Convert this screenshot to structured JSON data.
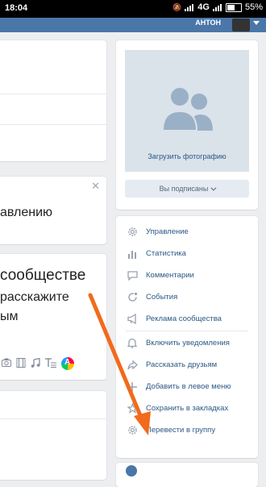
{
  "status_bar": {
    "time": "18:04",
    "network": "4G",
    "battery": "55%"
  },
  "header": {
    "user_name": "АНТОН"
  },
  "left_column": {
    "card2_text": "авлению",
    "card2_close": "✕",
    "card3_title": "сообществе",
    "card3_line1": "расскажите",
    "card3_line2": "ым"
  },
  "right_column": {
    "upload_photo_label": "Загрузить фотографию",
    "subscribed_label": "Вы подписаны",
    "menu": [
      {
        "icon": "gear-icon",
        "label": "Управление"
      },
      {
        "icon": "statistics-icon",
        "label": "Статистика"
      },
      {
        "icon": "comment-icon",
        "label": "Комментарии"
      },
      {
        "icon": "events-icon",
        "label": "События"
      },
      {
        "icon": "megaphone-icon",
        "label": "Реклама сообщества"
      },
      {
        "icon": "bell-icon",
        "label": "Включить уведомления"
      },
      {
        "icon": "share-icon",
        "label": "Рассказать друзьям"
      },
      {
        "icon": "plus-icon",
        "label": "Добавить в левое меню"
      },
      {
        "icon": "star-icon",
        "label": "Сохранить в закладках"
      },
      {
        "icon": "gear-icon",
        "label": "Перевести в группу"
      }
    ]
  },
  "colors": {
    "header": "#4a76a8",
    "link": "#2a5885",
    "arrow": "#f26a1b",
    "background": "#edeef0"
  }
}
